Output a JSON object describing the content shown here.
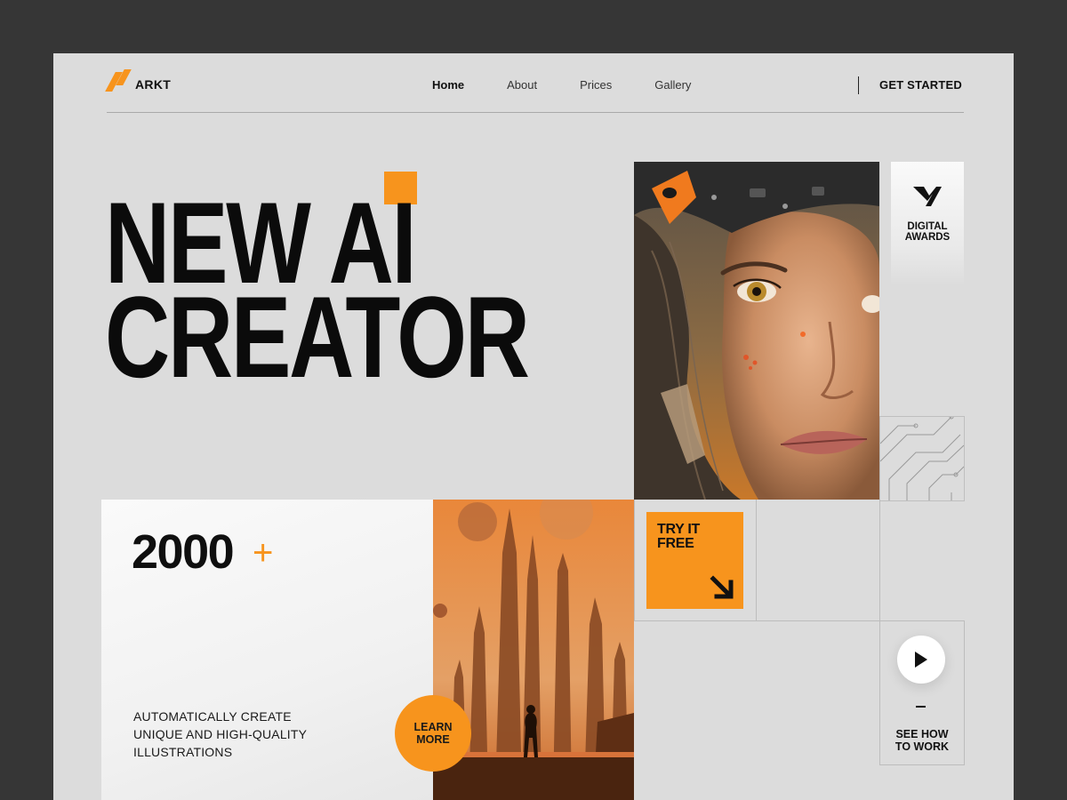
{
  "brand": {
    "name": "ARKT"
  },
  "nav": {
    "items": [
      {
        "label": "Home",
        "active": true
      },
      {
        "label": "About",
        "active": false
      },
      {
        "label": "Prices",
        "active": false
      },
      {
        "label": "Gallery",
        "active": false
      }
    ],
    "cta_label": "GET STARTED"
  },
  "hero": {
    "title_line1": "NEW AI",
    "title_line2": "CREATOR"
  },
  "awards": {
    "label_line1": "DIGITAL",
    "label_line2": "AWARDS",
    "icon": "award-logo-icon"
  },
  "stats": {
    "number": "2000",
    "plus": "+",
    "desc_line1": "AUTOMATICALLY CREATE",
    "desc_line2": "UNIQUE AND HIGH-QUALITY",
    "desc_line3": "ILLUSTRATIONS"
  },
  "learn_more": {
    "line1": "LEARN",
    "line2": "MORE"
  },
  "try_free": {
    "line1": "TRY IT",
    "line2": "FREE",
    "icon": "arrow-down-right-icon"
  },
  "how_to": {
    "line1": "SEE HOW",
    "line2": "TO WORK",
    "icon": "play-icon"
  },
  "colors": {
    "accent": "#f7941d",
    "background": "#dcdcdc",
    "frame": "#363636",
    "text": "#111111"
  }
}
